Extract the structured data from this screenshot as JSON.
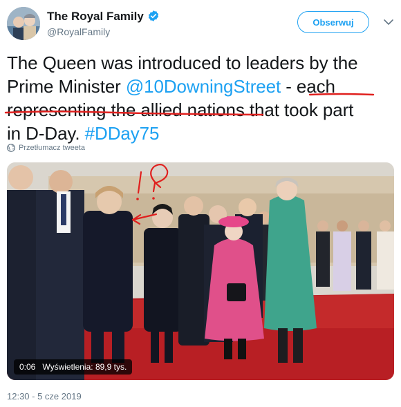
{
  "author": {
    "display_name": "The Royal Family",
    "handle": "@RoyalFamily",
    "verified": true
  },
  "follow_button": {
    "label": "Obserwuj"
  },
  "tweet": {
    "text_line1": "The Queen was introduced to leaders by the",
    "text_line2_plain": "Prime Minister ",
    "mention": "@10DowningStreet",
    "text_line2_sep": " - ",
    "text_line2_underlined": "each",
    "text_line3_underlined": "representing the allied nations",
    "text_line3_rest": " that took part",
    "text_line4_plain": "in D-Day. ",
    "hashtag": "#DDay75"
  },
  "translate": {
    "label": "Przetłumacz tweeta"
  },
  "video": {
    "duration": "0:06",
    "views": "Wyświetlenia: 89,9 tys."
  },
  "timestamp": "12:30 - 5 cze 2019",
  "colors": {
    "accent": "#1da1f2",
    "annotation": "#e0201e",
    "text": "#14171a",
    "muted": "#657786"
  }
}
